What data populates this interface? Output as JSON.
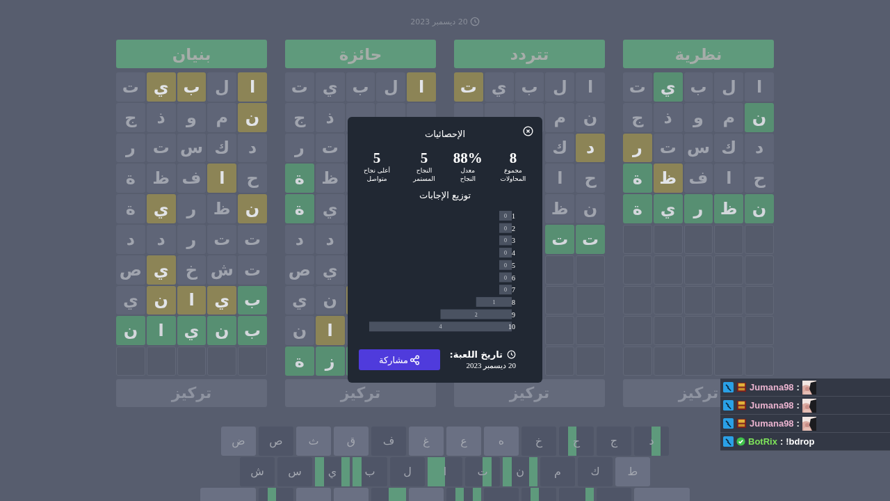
{
  "date": "20 ديسمبر 2023",
  "boards": [
    {
      "answer": "نظرية",
      "focus": "تركيز",
      "rows": [
        [
          {
            "letter": "ا",
            "kind": "absent"
          },
          {
            "letter": "ل",
            "kind": "absent"
          },
          {
            "letter": "ب",
            "kind": "absent"
          },
          {
            "letter": "ي",
            "kind": "correct"
          },
          {
            "letter": "ت",
            "kind": "absent"
          }
        ],
        [
          {
            "letter": "ن",
            "kind": "correct"
          },
          {
            "letter": "م",
            "kind": "absent"
          },
          {
            "letter": "و",
            "kind": "absent"
          },
          {
            "letter": "ذ",
            "kind": "absent"
          },
          {
            "letter": "ج",
            "kind": "absent"
          }
        ],
        [
          {
            "letter": "د",
            "kind": "absent"
          },
          {
            "letter": "ك",
            "kind": "absent"
          },
          {
            "letter": "س",
            "kind": "absent"
          },
          {
            "letter": "ت",
            "kind": "absent"
          },
          {
            "letter": "ر",
            "kind": "present"
          }
        ],
        [
          {
            "letter": "ح",
            "kind": "absent"
          },
          {
            "letter": "ا",
            "kind": "absent"
          },
          {
            "letter": "ف",
            "kind": "absent"
          },
          {
            "letter": "ظ",
            "kind": "present"
          },
          {
            "letter": "ة",
            "kind": "correct"
          }
        ],
        [
          {
            "letter": "ن",
            "kind": "correct"
          },
          {
            "letter": "ظ",
            "kind": "correct"
          },
          {
            "letter": "ر",
            "kind": "correct"
          },
          {
            "letter": "ي",
            "kind": "correct"
          },
          {
            "letter": "ة",
            "kind": "correct"
          }
        ],
        [
          {
            "kind": "empty"
          },
          {
            "kind": "empty"
          },
          {
            "kind": "empty"
          },
          {
            "kind": "empty"
          },
          {
            "kind": "empty"
          }
        ],
        [
          {
            "kind": "empty"
          },
          {
            "kind": "empty"
          },
          {
            "kind": "empty"
          },
          {
            "kind": "empty"
          },
          {
            "kind": "empty"
          }
        ],
        [
          {
            "kind": "empty"
          },
          {
            "kind": "empty"
          },
          {
            "kind": "empty"
          },
          {
            "kind": "empty"
          },
          {
            "kind": "empty"
          }
        ],
        [
          {
            "kind": "empty"
          },
          {
            "kind": "empty"
          },
          {
            "kind": "empty"
          },
          {
            "kind": "empty"
          },
          {
            "kind": "empty"
          }
        ],
        [
          {
            "kind": "empty"
          },
          {
            "kind": "empty"
          },
          {
            "kind": "empty"
          },
          {
            "kind": "empty"
          },
          {
            "kind": "empty"
          }
        ]
      ]
    },
    {
      "answer": "تتردد",
      "focus": "تركيز",
      "rows": [
        [
          {
            "letter": "ا",
            "kind": "absent"
          },
          {
            "letter": "ل",
            "kind": "absent"
          },
          {
            "letter": "ب",
            "kind": "absent"
          },
          {
            "letter": "ي",
            "kind": "absent"
          },
          {
            "letter": "ت",
            "kind": "present"
          }
        ],
        [
          {
            "letter": "ن",
            "kind": "absent"
          },
          {
            "letter": "م",
            "kind": "absent"
          },
          {
            "kind": "absent"
          },
          {
            "kind": "absent"
          },
          {
            "kind": "absent"
          }
        ],
        [
          {
            "letter": "د",
            "kind": "present"
          },
          {
            "letter": "ك",
            "kind": "absent"
          },
          null,
          null,
          null
        ],
        [
          {
            "letter": "ح",
            "kind": "absent"
          },
          {
            "letter": "ا",
            "kind": "absent"
          },
          null,
          null,
          null
        ],
        [
          {
            "letter": "ن",
            "kind": "absent"
          },
          {
            "letter": "ظ",
            "kind": "absent"
          },
          null,
          null,
          null
        ],
        [
          {
            "letter": "ت",
            "kind": "correct"
          },
          {
            "letter": "ت",
            "kind": "correct"
          },
          null,
          null,
          null
        ],
        [
          {
            "kind": "empty"
          },
          {
            "kind": "empty"
          },
          null,
          null,
          null
        ],
        [
          {
            "kind": "empty"
          },
          {
            "kind": "empty"
          },
          null,
          null,
          null
        ],
        [
          {
            "kind": "empty"
          },
          {
            "kind": "empty"
          },
          null,
          null,
          null
        ],
        [
          {
            "kind": "empty"
          },
          {
            "kind": "empty"
          },
          null,
          null,
          null
        ]
      ]
    },
    {
      "answer": "حائزة",
      "focus": "تركيز",
      "rows": [
        [
          {
            "letter": "ا",
            "kind": "present"
          },
          {
            "letter": "ل",
            "kind": "absent"
          },
          {
            "letter": "ب",
            "kind": "absent"
          },
          {
            "letter": "ي",
            "kind": "absent"
          },
          {
            "letter": "ت",
            "kind": "absent"
          }
        ],
        [
          {
            "kind": "absent"
          },
          {
            "kind": "absent"
          },
          {
            "kind": "absent"
          },
          {
            "letter": "ذ",
            "kind": "absent"
          },
          {
            "letter": "ج",
            "kind": "absent"
          }
        ],
        [
          null,
          null,
          {
            "kind": "absent"
          },
          {
            "letter": "ت",
            "kind": "absent"
          },
          {
            "letter": "ر",
            "kind": "absent"
          }
        ],
        [
          null,
          null,
          {
            "kind": "absent"
          },
          {
            "letter": "ظ",
            "kind": "absent"
          },
          {
            "letter": "ة",
            "kind": "correct"
          }
        ],
        [
          null,
          null,
          {
            "kind": "absent"
          },
          {
            "letter": "ي",
            "kind": "absent"
          },
          {
            "letter": "ة",
            "kind": "correct"
          }
        ],
        [
          null,
          null,
          {
            "kind": "absent"
          },
          {
            "letter": "د",
            "kind": "absent"
          },
          {
            "letter": "د",
            "kind": "absent"
          }
        ],
        [
          null,
          null,
          {
            "kind": "absent"
          },
          {
            "letter": "ي",
            "kind": "absent"
          },
          {
            "letter": "ص",
            "kind": "absent"
          }
        ],
        [
          null,
          null,
          {
            "kind": "present"
          },
          {
            "letter": "ن",
            "kind": "absent"
          },
          {
            "letter": "ي",
            "kind": "absent"
          }
        ],
        [
          null,
          null,
          {
            "kind": "absent"
          },
          {
            "letter": "ا",
            "kind": "present"
          },
          {
            "letter": "ن",
            "kind": "absent"
          }
        ],
        [
          null,
          null,
          {
            "kind": "correct"
          },
          {
            "letter": "ز",
            "kind": "correct"
          },
          {
            "letter": "ة",
            "kind": "correct"
          }
        ]
      ]
    },
    {
      "answer": "بنيان",
      "focus": "تركيز",
      "rows": [
        [
          {
            "letter": "ا",
            "kind": "present"
          },
          {
            "letter": "ل",
            "kind": "absent"
          },
          {
            "letter": "ب",
            "kind": "present"
          },
          {
            "letter": "ي",
            "kind": "present"
          },
          {
            "letter": "ت",
            "kind": "absent"
          }
        ],
        [
          {
            "letter": "ن",
            "kind": "present"
          },
          {
            "letter": "م",
            "kind": "absent"
          },
          {
            "letter": "و",
            "kind": "absent"
          },
          {
            "letter": "ذ",
            "kind": "absent"
          },
          {
            "letter": "ج",
            "kind": "absent"
          }
        ],
        [
          {
            "letter": "د",
            "kind": "absent"
          },
          {
            "letter": "ك",
            "kind": "absent"
          },
          {
            "letter": "س",
            "kind": "absent"
          },
          {
            "letter": "ت",
            "kind": "absent"
          },
          {
            "letter": "ر",
            "kind": "absent"
          }
        ],
        [
          {
            "letter": "ح",
            "kind": "absent"
          },
          {
            "letter": "ا",
            "kind": "present"
          },
          {
            "letter": "ف",
            "kind": "absent"
          },
          {
            "letter": "ظ",
            "kind": "absent"
          },
          {
            "letter": "ة",
            "kind": "absent"
          }
        ],
        [
          {
            "letter": "ن",
            "kind": "present"
          },
          {
            "letter": "ظ",
            "kind": "absent"
          },
          {
            "letter": "ر",
            "kind": "absent"
          },
          {
            "letter": "ي",
            "kind": "present"
          },
          {
            "letter": "ة",
            "kind": "absent"
          }
        ],
        [
          {
            "letter": "ت",
            "kind": "absent"
          },
          {
            "letter": "ت",
            "kind": "absent"
          },
          {
            "letter": "ر",
            "kind": "absent"
          },
          {
            "letter": "د",
            "kind": "absent"
          },
          {
            "letter": "د",
            "kind": "absent"
          }
        ],
        [
          {
            "letter": "ت",
            "kind": "absent"
          },
          {
            "letter": "ش",
            "kind": "absent"
          },
          {
            "letter": "خ",
            "kind": "absent"
          },
          {
            "letter": "ي",
            "kind": "present"
          },
          {
            "letter": "ص",
            "kind": "absent"
          }
        ],
        [
          {
            "letter": "ب",
            "kind": "correct"
          },
          {
            "letter": "ي",
            "kind": "present"
          },
          {
            "letter": "ا",
            "kind": "present"
          },
          {
            "letter": "ن",
            "kind": "present"
          },
          {
            "letter": "ي",
            "kind": "absent"
          }
        ],
        [
          {
            "letter": "ب",
            "kind": "correct"
          },
          {
            "letter": "ن",
            "kind": "correct"
          },
          {
            "letter": "ي",
            "kind": "correct"
          },
          {
            "letter": "ا",
            "kind": "correct"
          },
          {
            "letter": "ن",
            "kind": "correct"
          }
        ],
        [
          {
            "kind": "empty"
          },
          {
            "kind": "empty"
          },
          {
            "kind": "empty"
          },
          {
            "kind": "empty"
          },
          {
            "kind": "empty"
          }
        ]
      ]
    }
  ],
  "keyboard": {
    "rows": [
      [
        {
          "label": "د",
          "used": true,
          "marks": [
            false,
            true,
            false,
            false
          ]
        },
        {
          "label": "ج",
          "used": true,
          "marks": [
            false,
            false,
            false,
            false
          ]
        },
        {
          "label": "ح",
          "used": true,
          "marks": [
            false,
            false,
            true,
            false
          ]
        },
        {
          "label": "خ",
          "used": true,
          "marks": [
            false,
            false,
            false,
            false
          ]
        },
        {
          "label": "ه",
          "used": false,
          "marks": [
            false,
            false,
            false,
            false
          ]
        },
        {
          "label": "ع",
          "used": false,
          "marks": [
            false,
            false,
            false,
            false
          ]
        },
        {
          "label": "غ",
          "used": false,
          "marks": [
            false,
            false,
            false,
            false
          ]
        },
        {
          "label": "ف",
          "used": true,
          "marks": [
            false,
            false,
            false,
            false
          ]
        },
        {
          "label": "ق",
          "used": false,
          "marks": [
            false,
            false,
            false,
            false
          ]
        },
        {
          "label": "ث",
          "used": false,
          "marks": [
            false,
            false,
            false,
            false
          ]
        },
        {
          "label": "ص",
          "used": true,
          "marks": [
            false,
            false,
            false,
            false
          ]
        },
        {
          "label": "ض",
          "used": false,
          "marks": [
            false,
            false,
            false,
            false
          ]
        }
      ],
      [
        {
          "label": "ط",
          "used": false,
          "marks": [
            false,
            false,
            false,
            false
          ]
        },
        {
          "label": "ك",
          "used": true,
          "marks": [
            false,
            false,
            false,
            false
          ]
        },
        {
          "label": "م",
          "used": true,
          "marks": [
            false,
            false,
            false,
            false
          ]
        },
        {
          "label": "ن",
          "used": true,
          "marks": [
            true,
            false,
            false,
            true
          ]
        },
        {
          "label": "ت",
          "used": true,
          "marks": [
            false,
            true,
            false,
            false
          ]
        },
        {
          "label": "ا",
          "used": true,
          "marks": [
            false,
            false,
            true,
            true
          ]
        },
        {
          "label": "ل",
          "used": true,
          "marks": [
            false,
            false,
            false,
            false
          ]
        },
        {
          "label": "ب",
          "used": true,
          "marks": [
            false,
            false,
            false,
            true
          ]
        },
        {
          "label": "ي",
          "used": true,
          "marks": [
            true,
            false,
            false,
            true
          ]
        },
        {
          "label": "س",
          "used": true,
          "marks": [
            false,
            false,
            false,
            false
          ]
        },
        {
          "label": "ش",
          "used": true,
          "marks": [
            false,
            false,
            false,
            false
          ]
        }
      ],
      [
        {
          "kind": "wide",
          "used": false,
          "marks": [
            false,
            false,
            false,
            false
          ]
        },
        {
          "kind": "letter",
          "used": true,
          "marks": [
            false,
            false,
            false,
            false
          ]
        },
        {
          "kind": "letter",
          "used": true,
          "marks": [
            true,
            false,
            false,
            false
          ]
        },
        {
          "kind": "letter",
          "used": true,
          "marks": [
            false,
            false,
            true,
            false
          ]
        },
        {
          "kind": "letter",
          "used": true,
          "marks": [
            false,
            false,
            false,
            false
          ]
        },
        {
          "kind": "letter",
          "used": true,
          "marks": [
            true,
            false,
            true,
            false
          ]
        },
        {
          "kind": "letter",
          "used": false,
          "marks": [
            false,
            false,
            false,
            false
          ]
        },
        {
          "kind": "letter",
          "used": true,
          "marks": [
            true,
            true,
            false,
            false
          ]
        },
        {
          "kind": "letter",
          "used": false,
          "marks": [
            false,
            false,
            false,
            false
          ]
        },
        {
          "kind": "letter",
          "used": false,
          "marks": [
            false,
            false,
            false,
            false
          ]
        },
        {
          "kind": "letter",
          "used": true,
          "marks": [
            false,
            false,
            true,
            false
          ]
        },
        {
          "kind": "wide",
          "used": false,
          "marks": [
            false,
            false,
            false,
            false
          ]
        }
      ]
    ]
  },
  "stats_modal": {
    "title": "الإحصائيات",
    "stats": [
      {
        "value": "8",
        "label": "مجموع المحاولات"
      },
      {
        "value": "88%",
        "label": "معدل النجاح"
      },
      {
        "value": "5",
        "label": "النجاح المستمر"
      },
      {
        "value": "5",
        "label": "أعلى نجاح متواصل"
      }
    ],
    "distribution_title": "توزيع الإجابات",
    "chart_data": {
      "type": "bar",
      "orientation": "horizontal",
      "categories": [
        "1",
        "2",
        "3",
        "4",
        "5",
        "6",
        "7",
        "8",
        "9",
        "10"
      ],
      "series": [
        {
          "color": "#4a5261",
          "values": [
            0,
            0,
            0,
            0,
            0,
            0,
            0,
            1,
            2,
            4
          ]
        }
      ],
      "data_labels": true
    },
    "game_date_label": "تاريخ اللعبة:",
    "game_date": "20 ديسمبر 2023",
    "share_button": "مشاركة"
  },
  "chat": [
    {
      "badges": [
        {
          "kind": "mod"
        },
        {
          "kind": "sub"
        }
      ],
      "user": "Jumana98",
      "color": "#eab3cf",
      "separator": ":",
      "kind": "emote"
    },
    {
      "badges": [
        {
          "kind": "mod"
        },
        {
          "kind": "sub"
        }
      ],
      "user": "Jumana98",
      "color": "#eab3cf",
      "separator": ":",
      "kind": "emote"
    },
    {
      "badges": [
        {
          "kind": "mod"
        },
        {
          "kind": "sub"
        }
      ],
      "user": "Jumana98",
      "color": "#eab3cf",
      "separator": ":",
      "kind": "emote"
    },
    {
      "badges": [
        {
          "kind": "mod"
        },
        {
          "kind": "verified"
        }
      ],
      "user": "BotRix",
      "color": "#7ee35a",
      "separator": ":",
      "kind": "text",
      "text": "!bdrop"
    }
  ]
}
